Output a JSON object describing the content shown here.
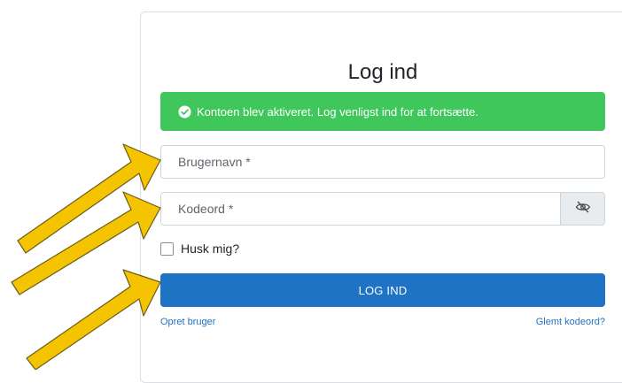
{
  "title": "Log ind",
  "alert": {
    "message": "Kontoen blev aktiveret. Log venligst ind for at fortsætte.",
    "icon": "check-circle-icon",
    "color": "#3fc75b"
  },
  "username": {
    "placeholder": "Brugernavn *",
    "value": ""
  },
  "password": {
    "placeholder": "Kodeord *",
    "value": "",
    "toggle_icon": "eye-slash-icon"
  },
  "remember": {
    "label": "Husk mig?",
    "checked": false
  },
  "login_button": {
    "label": "LOG IND",
    "color": "#1f73c4"
  },
  "links": {
    "create_account": "Opret bruger",
    "forgot_password": "Glemt kodeord?"
  },
  "annotation_color": "#f5c400"
}
